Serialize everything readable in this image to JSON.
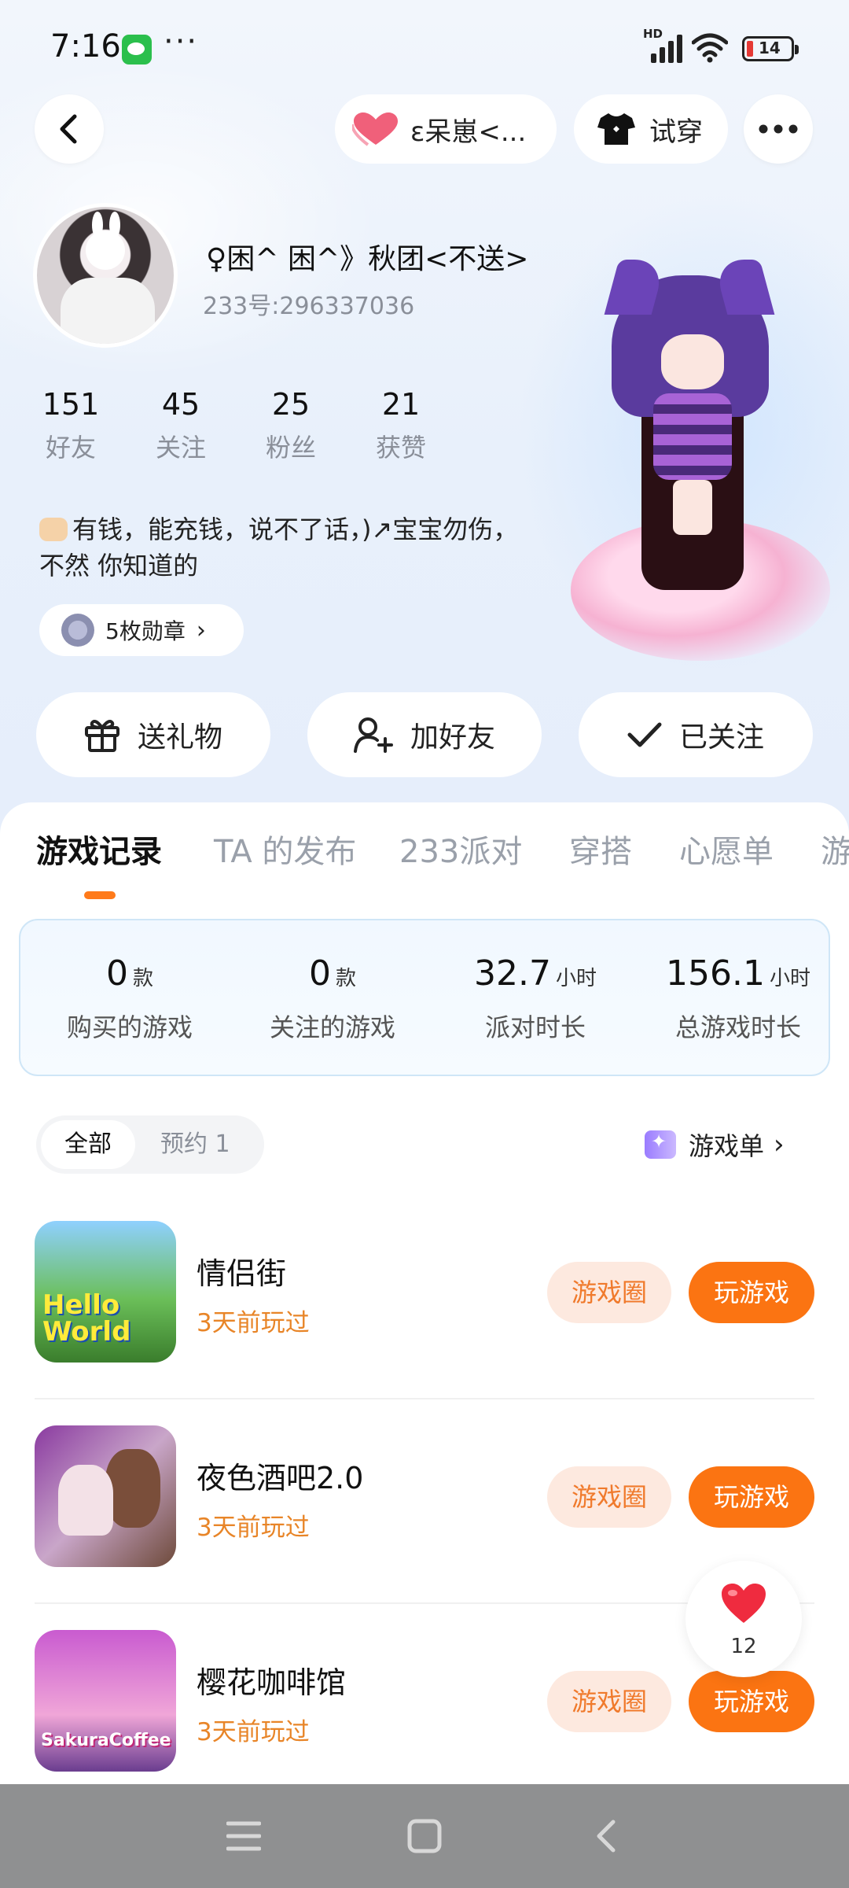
{
  "status_bar": {
    "time": "7:16",
    "dots": "···",
    "hd": "HD",
    "battery": "14"
  },
  "top_nav": {
    "game_pill_label": "ε呆崽<...",
    "try_on_label": "试穿"
  },
  "profile": {
    "nickname": "♀困^ 困^》秋团<不送>",
    "uid": "233号:296337036",
    "stats": [
      {
        "value": "151",
        "label": "好友"
      },
      {
        "value": "45",
        "label": "关注"
      },
      {
        "value": "25",
        "label": "粉丝"
      },
      {
        "value": "21",
        "label": "获赞"
      }
    ],
    "bio_line1": "有钱，能充钱，说不了话，)↗宝宝勿伤，",
    "bio_line2": "不然 你知道的",
    "medals": "5枚勋章"
  },
  "actions": {
    "gift": "送礼物",
    "add_friend": "加好友",
    "followed": "已关注"
  },
  "tabs": [
    "游戏记录",
    "TA 的发布",
    "233派对",
    "穿搭",
    "心愿单",
    "游"
  ],
  "summary": [
    {
      "value": "0",
      "unit": "款",
      "label": "购买的游戏"
    },
    {
      "value": "0",
      "unit": "款",
      "label": "关注的游戏"
    },
    {
      "value": "32.7",
      "unit": "小时",
      "label": "派对时长"
    },
    {
      "value": "156.1",
      "unit": "小时",
      "label": "总游戏时长"
    }
  ],
  "filter": {
    "all": "全部",
    "reserved": "预约 1",
    "game_list": "游戏单"
  },
  "games": [
    {
      "name": "情侣街",
      "played": "3天前玩过",
      "icon_text": "Hello World",
      "circle": "游戏圈",
      "play": "玩游戏"
    },
    {
      "name": "夜色酒吧2.0",
      "played": "3天前玩过",
      "icon_text": "",
      "circle": "游戏圈",
      "play": "玩游戏"
    },
    {
      "name": "樱花咖啡馆",
      "played": "3天前玩过",
      "icon_text": "SakuraCoffee",
      "circle": "游戏圈",
      "play": "玩游戏"
    }
  ],
  "like_fab": {
    "count": "12"
  },
  "colors": {
    "accent": "#fb7412",
    "accent_soft": "#fde9df",
    "played": "#e88528"
  }
}
